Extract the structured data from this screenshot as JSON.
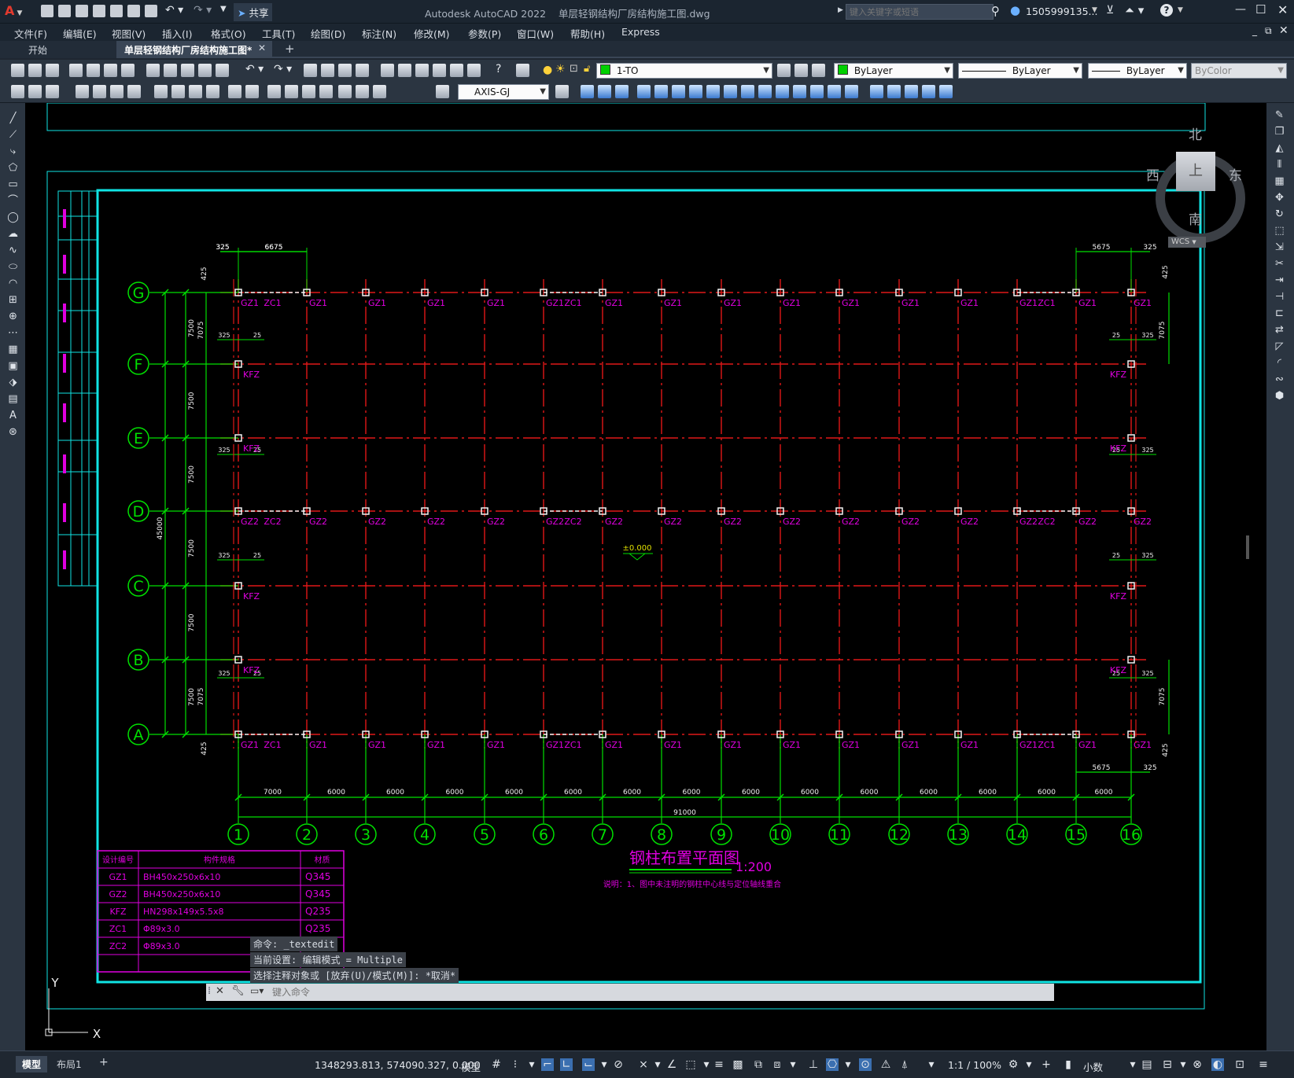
{
  "titlebar": {
    "app_title": "Autodesk AutoCAD 2022",
    "doc_title": "单层轻钢结构厂房结构施工图.dwg",
    "share_label": "共享",
    "search_placeholder": "键入关键字或短语",
    "user": "1505999135..."
  },
  "menu": [
    "文件(F)",
    "编辑(E)",
    "视图(V)",
    "插入(I)",
    "格式(O)",
    "工具(T)",
    "绘图(D)",
    "标注(N)",
    "修改(M)",
    "参数(P)",
    "窗口(W)",
    "帮助(H)",
    "Express"
  ],
  "tabs": {
    "start": "开始",
    "drawing": "单层轻钢结构厂房结构施工图*",
    "add": "+"
  },
  "toolbar": {
    "layer": "1-TO",
    "color": "ByLayer",
    "linetype": "ByLayer",
    "lineweight": "ByLayer",
    "plotstyle": "ByColor",
    "dimstyle": "AXIS-GJ"
  },
  "viewcube": {
    "north": "北",
    "south": "南",
    "east": "东",
    "west": "西",
    "face": "上",
    "wcs": "WCS"
  },
  "drawing": {
    "title": "钢柱布置平面图",
    "scale": "1:200",
    "note": "说明：1、图中未注明的钢柱中心线与定位轴线重合",
    "elevation": "±0.000",
    "row_axes": [
      "G",
      "F",
      "E",
      "D",
      "C",
      "B",
      "A"
    ],
    "col_axes": [
      "1",
      "2",
      "3",
      "4",
      "5",
      "6",
      "7",
      "8",
      "9",
      "10",
      "11",
      "12",
      "13",
      "14",
      "15",
      "16"
    ],
    "bottom_dims": [
      "7000",
      "6000",
      "6000",
      "6000",
      "6000",
      "6000",
      "6000",
      "6000",
      "6000",
      "6000",
      "6000",
      "6000",
      "6000",
      "6000",
      "6000"
    ],
    "total_width": "91000",
    "total_depth": "45000",
    "bay_depth": "7500",
    "gable_depth": "7075",
    "dim_325": "325",
    "dim_25": "25",
    "dim_425": "425",
    "dim_6675": "6675",
    "dim_5675": "5675",
    "labels": {
      "gz1": "GZ1",
      "gz2": "GZ2",
      "zc1": "ZC1",
      "zc2": "ZC2",
      "kfz": "KFZ"
    },
    "ucs": {
      "y": "Y",
      "x": "X"
    },
    "table": {
      "headers": [
        "设计编号",
        "构件规格",
        "材质"
      ],
      "rows": [
        [
          "GZ1",
          "BH450x250x6x10",
          "Q345"
        ],
        [
          "GZ2",
          "BH450x250x6x10",
          "Q345"
        ],
        [
          "KFZ",
          "HN298x149x5.5x8",
          "Q235"
        ],
        [
          "ZC1",
          "Φ89x3.0",
          "Q235"
        ],
        [
          "ZC2",
          "Φ89x3.0",
          "Q235"
        ]
      ]
    }
  },
  "command": {
    "history": [
      "命令: _textedit",
      "当前设置: 编辑模式 = Multiple",
      "选择注释对象或 [放弃(U)/模式(M)]: *取消*"
    ],
    "placeholder": "键入命令"
  },
  "status": {
    "model_tab": "模型",
    "layout_tab": "布局1",
    "coords": "1348293.813, 574090.327, 0.000",
    "space": "模型",
    "scale": "1:1 / 100%",
    "units": "小数"
  }
}
